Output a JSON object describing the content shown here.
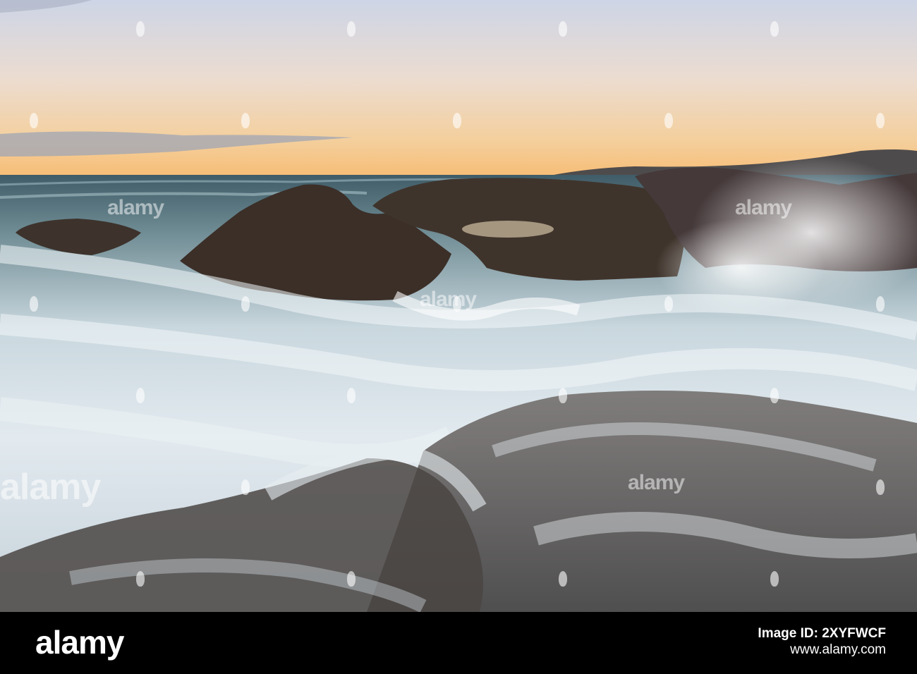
{
  "photo": {
    "subject": "long-exposure seascape at dusk",
    "colors": {
      "sky_top": "#cfd6e6",
      "sky_mid": "#f1dcc8",
      "horizon": "#f6c27c",
      "sea_far": "#3d5a66",
      "foam": "#dfe8ee",
      "rock": "#3a2f28",
      "headland": "#4d4a4a"
    }
  },
  "watermark": {
    "text": "alamy"
  },
  "footer": {
    "logo": "alamy",
    "image_id": "Image ID: 2XYFWCF",
    "url": "www.alamy.com"
  }
}
